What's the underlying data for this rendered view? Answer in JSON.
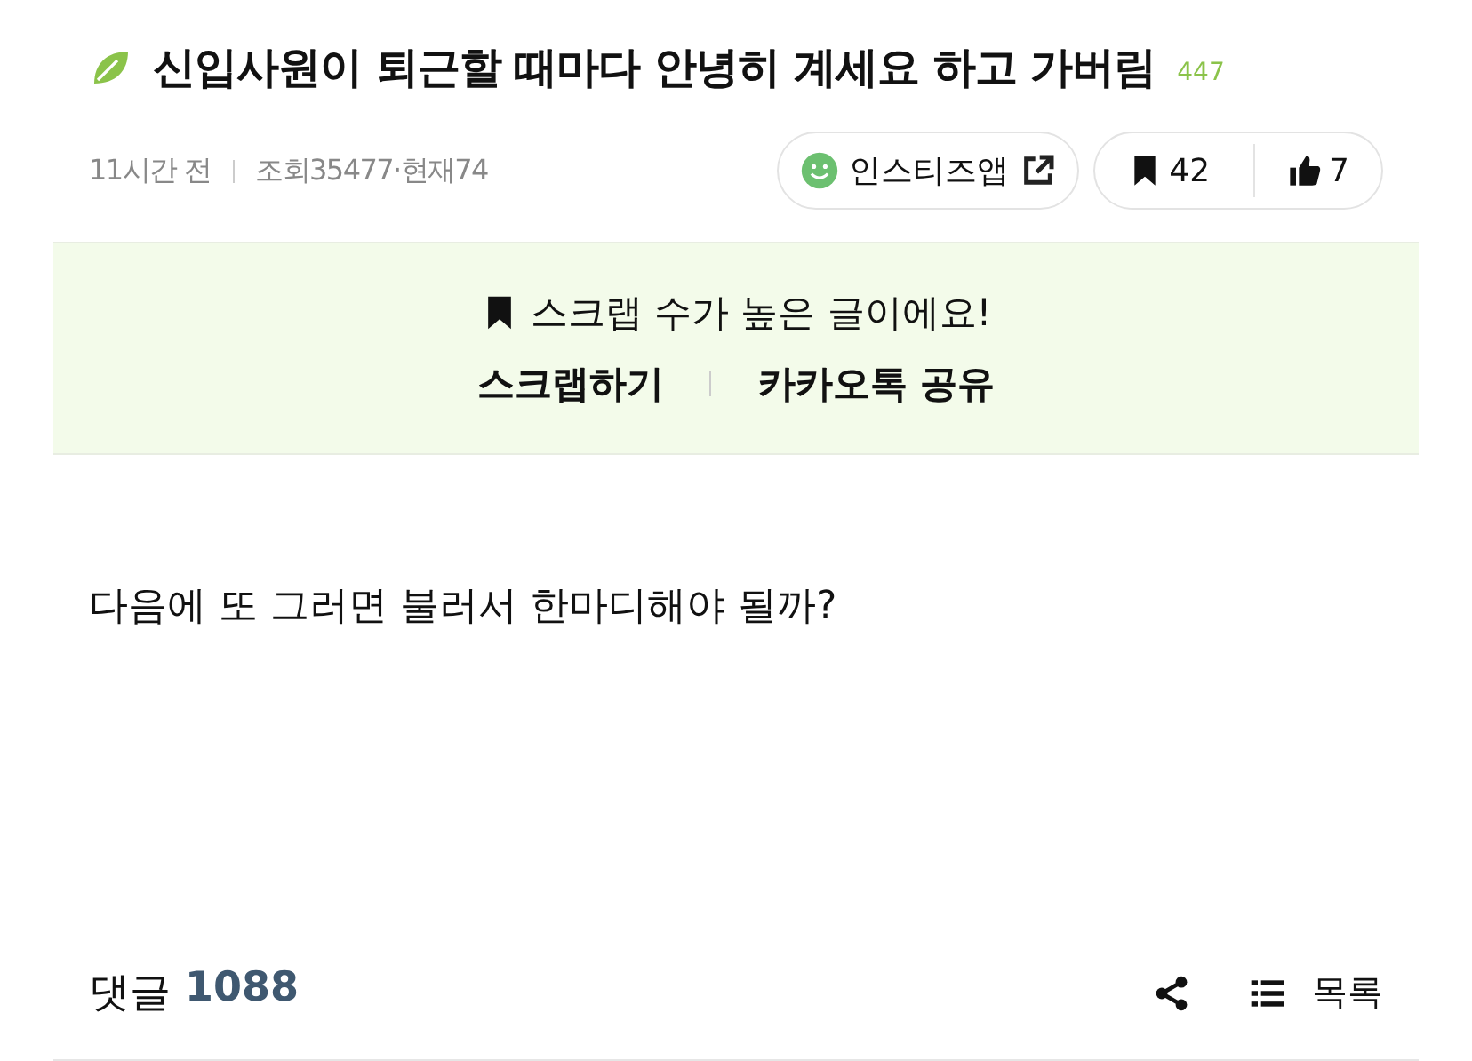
{
  "post": {
    "title": "신입사원이 퇴근할 때마다 안녕히 계세요 하고 가버림",
    "title_count": "447",
    "time": "11시간 전",
    "views": "조회35477",
    "current": "·현재74",
    "source": "인스티즈앱",
    "scraps": "42",
    "likes": "7"
  },
  "banner": {
    "message": "스크랩 수가 높은 글이에요!",
    "actions": [
      "스크랩하기",
      "카카오톡 공유"
    ]
  },
  "body": "다음에 또 그러면 불러서 한마디해야 될까?",
  "footer": {
    "comments_label": "댓글",
    "comments_count": "1088",
    "list_label": "목록"
  }
}
